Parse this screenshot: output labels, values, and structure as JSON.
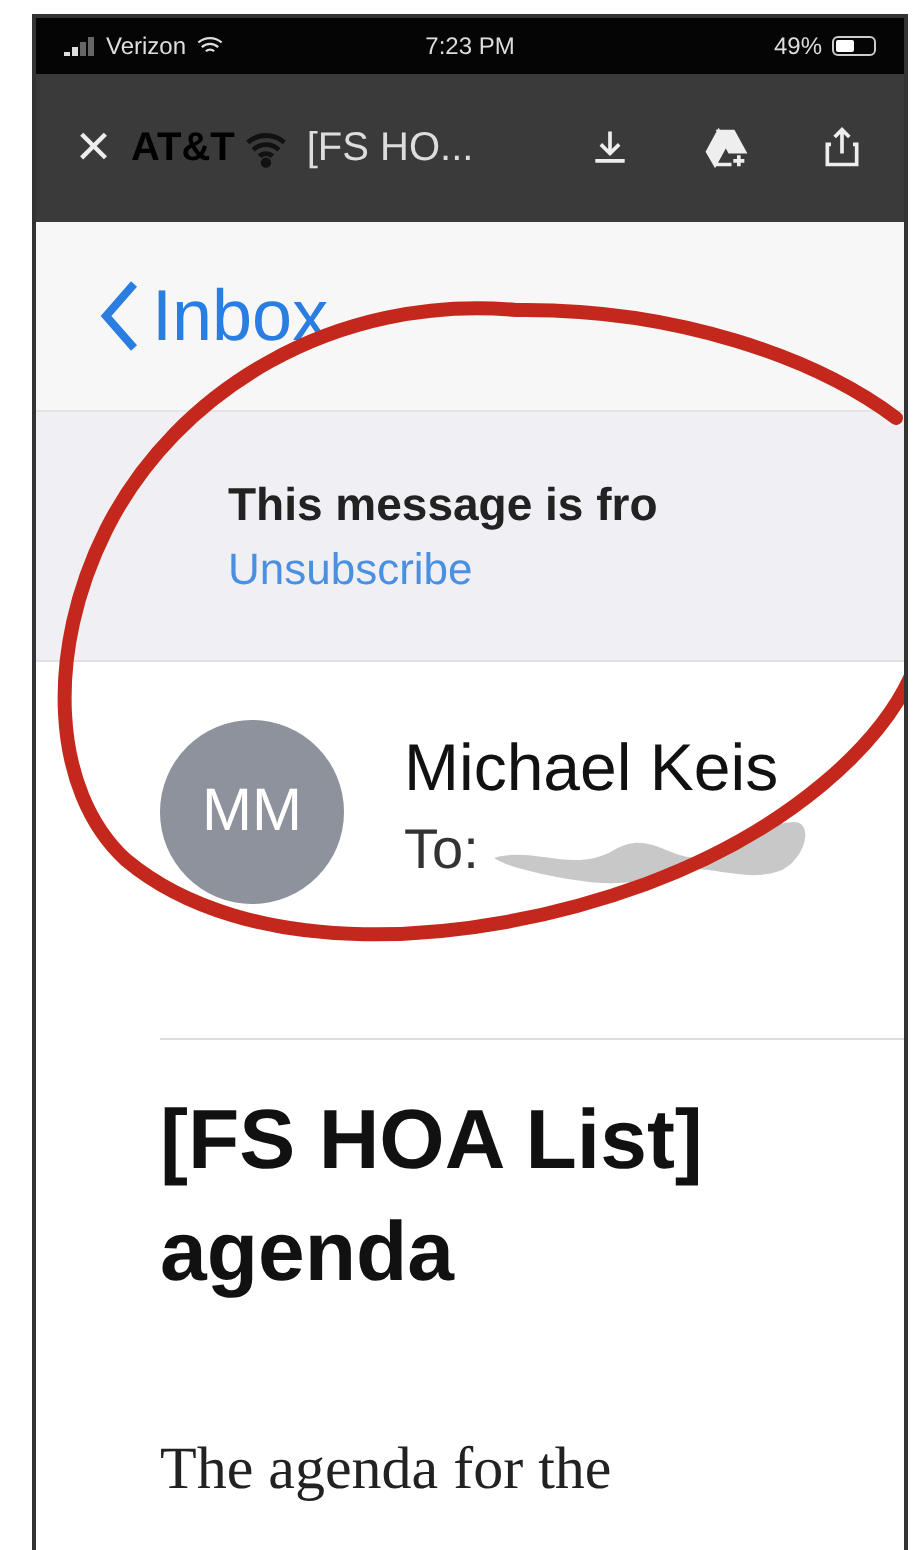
{
  "status_bar": {
    "carrier": "Verizon",
    "time": "7:23 PM",
    "battery": "49%"
  },
  "toolbar": {
    "close": "×",
    "ghost_carrier": "AT&T",
    "title": "[FS HO..."
  },
  "nav": {
    "back": "Inbox"
  },
  "banner": {
    "text": "This message is fro",
    "link": "Unsubscribe"
  },
  "sender": {
    "initials": "MM",
    "name": "Michael Keis",
    "to_label": "To:"
  },
  "subject": "[FS HOA List] agenda",
  "body": "The agenda for the"
}
